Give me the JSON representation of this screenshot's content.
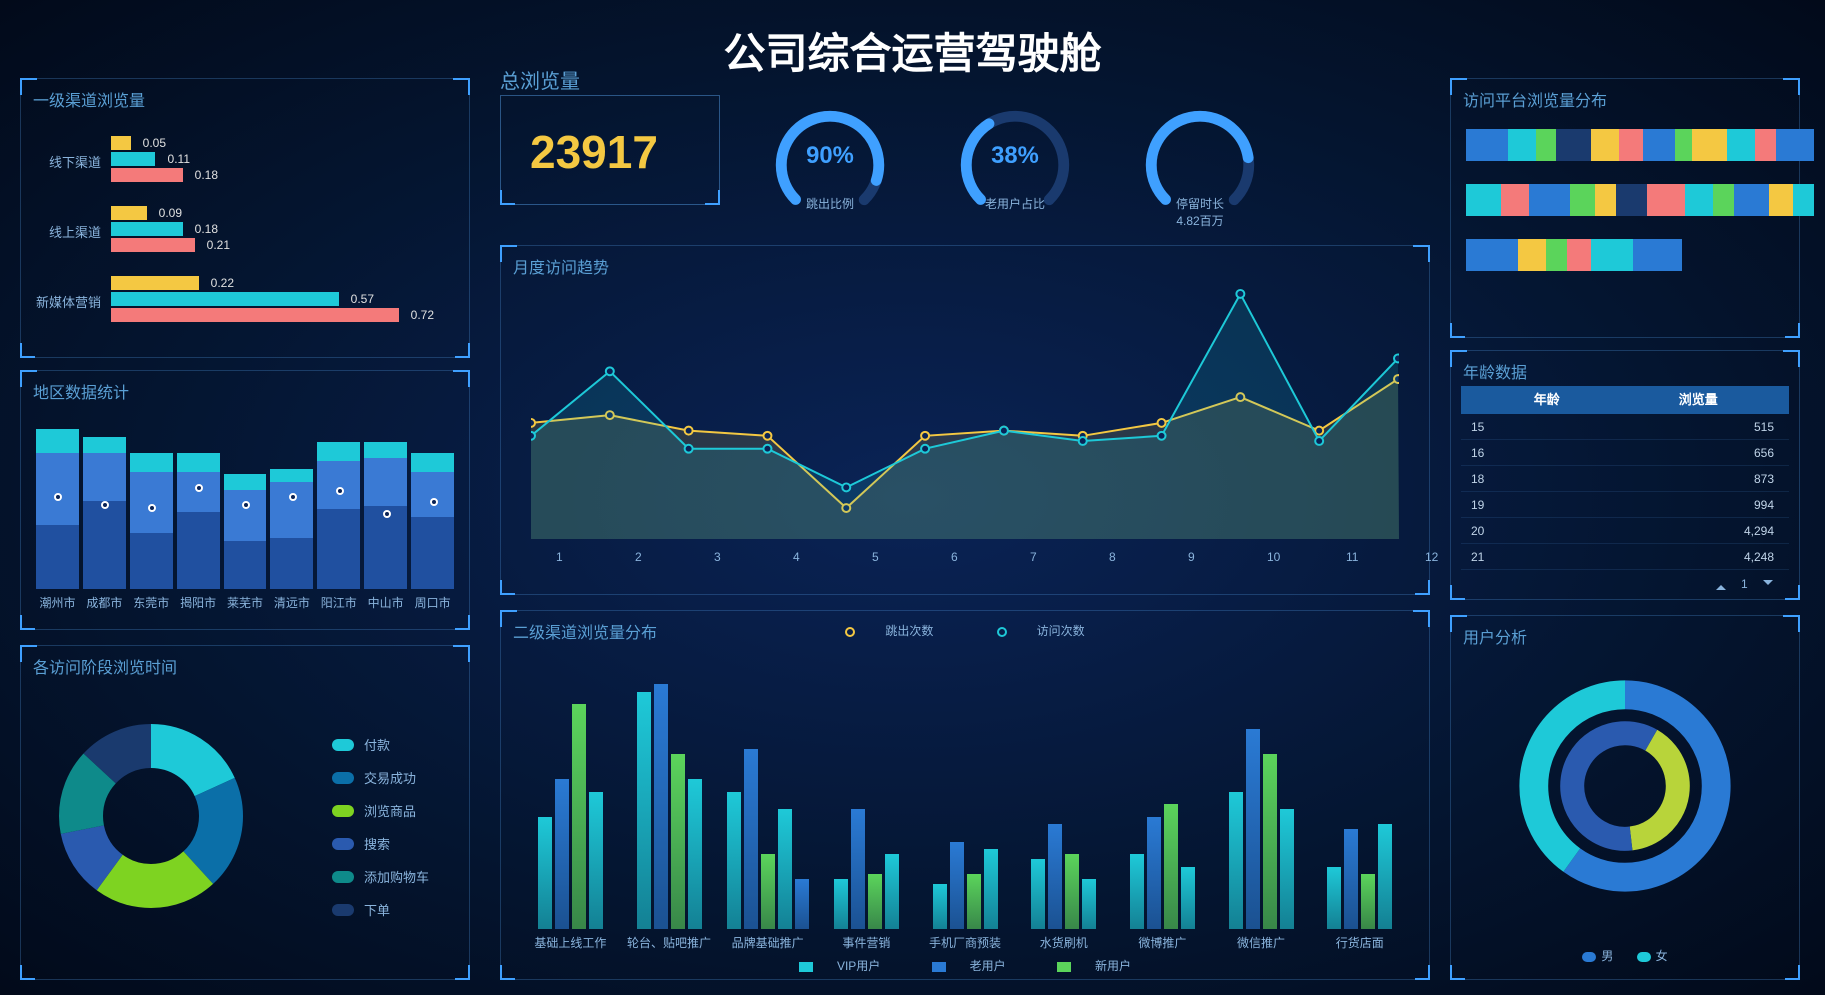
{
  "title": "公司综合运营驾驶舱",
  "kpi": {
    "label": "总浏览量",
    "value": "23917"
  },
  "gauges": [
    {
      "pct": 90,
      "text": "90%",
      "label": "跳出比例"
    },
    {
      "pct": 38,
      "text": "38%",
      "label": "老用户占比"
    },
    {
      "pct": 80,
      "text": "",
      "label": "停留时长\n4.82百万"
    }
  ],
  "tl": {
    "title": "一级渠道浏览量",
    "groups": [
      {
        "label": "线下渠道",
        "bars": [
          0.05,
          0.11,
          0.18
        ]
      },
      {
        "label": "线上渠道",
        "bars": [
          0.09,
          0.18,
          0.21
        ]
      },
      {
        "label": "新媒体营销",
        "bars": [
          0.22,
          0.57,
          0.72
        ]
      }
    ],
    "colors": [
      "#f4c842",
      "#1ec9d8",
      "#f47a7a"
    ]
  },
  "ml": {
    "title": "地区数据统计",
    "cats": [
      "潮州市",
      "成都市",
      "东莞市",
      "揭阳市",
      "莱芜市",
      "清远市",
      "阳江市",
      "中山市",
      "周口市"
    ],
    "stacks": [
      [
        40,
        45,
        15
      ],
      [
        55,
        30,
        10
      ],
      [
        35,
        38,
        12
      ],
      [
        48,
        25,
        12
      ],
      [
        30,
        32,
        10
      ],
      [
        32,
        35,
        8
      ],
      [
        50,
        30,
        12
      ],
      [
        52,
        30,
        10
      ],
      [
        45,
        28,
        12
      ]
    ],
    "line": [
      0.55,
      0.5,
      0.48,
      0.6,
      0.5,
      0.55,
      0.58,
      0.45,
      0.52
    ]
  },
  "bl": {
    "title": "各访问阶段浏览时间",
    "items": [
      {
        "label": "付款",
        "color": "#1ec9d8"
      },
      {
        "label": "交易成功",
        "color": "#0b6fa8"
      },
      {
        "label": "浏览商品",
        "color": "#7ed321"
      },
      {
        "label": "搜索",
        "color": "#2a5aaf"
      },
      {
        "label": "添加购物车",
        "color": "#0e8a8a"
      },
      {
        "label": "下单",
        "color": "#1a3a6e"
      }
    ]
  },
  "cm": {
    "title": "月度访问趋势",
    "x": [
      "1",
      "2",
      "3",
      "4",
      "5",
      "6",
      "7",
      "8",
      "9",
      "10",
      "11",
      "12"
    ],
    "series": [
      {
        "name": "跳出次数",
        "color": "#f4c842",
        "data": [
          0.45,
          0.48,
          0.42,
          0.4,
          0.12,
          0.4,
          0.42,
          0.4,
          0.45,
          0.55,
          0.42,
          0.62
        ]
      },
      {
        "name": "访问次数",
        "color": "#1ec9d8",
        "data": [
          0.4,
          0.65,
          0.35,
          0.35,
          0.2,
          0.35,
          0.42,
          0.38,
          0.4,
          0.95,
          0.38,
          0.7
        ]
      }
    ]
  },
  "cb": {
    "title": "二级渠道浏览量分布",
    "cats": [
      "基础上线工作",
      "轮台、贴吧推广",
      "品牌基础推广",
      "事件营销",
      "手机厂商预装",
      "水货刷机",
      "微博推广",
      "微信推广",
      "行货店面"
    ],
    "series": [
      "VIP用户",
      "老用户",
      "新用户"
    ],
    "colors": [
      "#1ec9d8",
      "#2a7ad4",
      "#5bd45b"
    ],
    "data": [
      [
        45,
        60,
        90,
        55
      ],
      [
        95,
        98,
        70,
        60
      ],
      [
        55,
        72,
        30,
        48,
        20
      ],
      [
        20,
        48,
        22,
        30
      ],
      [
        18,
        35,
        22,
        32
      ],
      [
        28,
        42,
        30,
        20
      ],
      [
        30,
        45,
        50,
        25
      ],
      [
        55,
        80,
        70,
        48
      ],
      [
        25,
        40,
        22,
        42
      ]
    ]
  },
  "rt": {
    "title": "访问平台浏览量分布",
    "rows": [
      [
        [
          "#2a7ad4",
          12
        ],
        [
          "#1ec9d8",
          8
        ],
        [
          "#5bd45b",
          6
        ],
        [
          "#1a3a6e",
          10
        ],
        [
          "#f4c842",
          8
        ],
        [
          "#f47a7a",
          7
        ],
        [
          "#2a7ad4",
          9
        ],
        [
          "#5bd45b",
          5
        ],
        [
          "#f4c842",
          10
        ],
        [
          "#1ec9d8",
          8
        ],
        [
          "#f47a7a",
          6
        ],
        [
          "#2a7ad4",
          11
        ]
      ],
      [
        [
          "#1ec9d8",
          10
        ],
        [
          "#f47a7a",
          8
        ],
        [
          "#2a7ad4",
          12
        ],
        [
          "#5bd45b",
          7
        ],
        [
          "#f4c842",
          6
        ],
        [
          "#1a3a6e",
          9
        ],
        [
          "#f47a7a",
          11
        ],
        [
          "#1ec9d8",
          8
        ],
        [
          "#5bd45b",
          6
        ],
        [
          "#2a7ad4",
          10
        ],
        [
          "#f4c842",
          7
        ],
        [
          "#1ec9d8",
          6
        ]
      ],
      [
        [
          "#2a7ad4",
          15
        ],
        [
          "#f4c842",
          8
        ],
        [
          "#5bd45b",
          6
        ],
        [
          "#f47a7a",
          7
        ],
        [
          "#1ec9d8",
          12
        ],
        [
          "#2a7ad4",
          14
        ]
      ]
    ]
  },
  "rm": {
    "title": "年龄数据",
    "headers": [
      "年龄",
      "浏览量"
    ],
    "rows": [
      [
        "15",
        "515"
      ],
      [
        "16",
        "656"
      ],
      [
        "18",
        "873"
      ],
      [
        "19",
        "994"
      ],
      [
        "20",
        "4,294"
      ],
      [
        "21",
        "4,248"
      ]
    ],
    "page": "1"
  },
  "rb": {
    "title": "用户分析",
    "legend": [
      "男",
      "女"
    ]
  },
  "chart_data": [
    {
      "type": "bar",
      "orientation": "horizontal",
      "title": "一级渠道浏览量",
      "categories": [
        "线下渠道",
        "线上渠道",
        "新媒体营销"
      ],
      "series": [
        {
          "name": "s1",
          "values": [
            0.05,
            0.09,
            0.22
          ]
        },
        {
          "name": "s2",
          "values": [
            0.11,
            0.18,
            0.57
          ]
        },
        {
          "name": "s3",
          "values": [
            0.18,
            0.21,
            0.72
          ]
        }
      ],
      "xlim": [
        0,
        0.8
      ]
    },
    {
      "type": "bar",
      "title": "地区数据统计",
      "stacked": true,
      "categories": [
        "潮州市",
        "成都市",
        "东莞市",
        "揭阳市",
        "莱芜市",
        "清远市",
        "阳江市",
        "中山市",
        "周口市"
      ],
      "series": [
        {
          "name": "seg1",
          "values": [
            40,
            55,
            35,
            48,
            30,
            32,
            50,
            52,
            45
          ]
        },
        {
          "name": "seg2",
          "values": [
            45,
            30,
            38,
            25,
            32,
            35,
            30,
            30,
            28
          ]
        },
        {
          "name": "seg3",
          "values": [
            15,
            10,
            12,
            12,
            10,
            8,
            12,
            10,
            12
          ]
        }
      ],
      "line_overlay": [
        0.55,
        0.5,
        0.48,
        0.6,
        0.5,
        0.55,
        0.58,
        0.45,
        0.52
      ]
    },
    {
      "type": "pie",
      "title": "各访问阶段浏览时间",
      "slices": [
        {
          "label": "付款",
          "value": 18
        },
        {
          "label": "交易成功",
          "value": 20
        },
        {
          "label": "浏览商品",
          "value": 22
        },
        {
          "label": "搜索",
          "value": 12
        },
        {
          "label": "添加购物车",
          "value": 15
        },
        {
          "label": "下单",
          "value": 13
        }
      ]
    },
    {
      "type": "line",
      "title": "月度访问趋势",
      "x": [
        1,
        2,
        3,
        4,
        5,
        6,
        7,
        8,
        9,
        10,
        11,
        12
      ],
      "series": [
        {
          "name": "跳出次数",
          "values": [
            0.45,
            0.48,
            0.42,
            0.4,
            0.12,
            0.4,
            0.42,
            0.4,
            0.45,
            0.55,
            0.42,
            0.62
          ]
        },
        {
          "name": "访问次数",
          "values": [
            0.4,
            0.65,
            0.35,
            0.35,
            0.2,
            0.35,
            0.42,
            0.38,
            0.4,
            0.95,
            0.38,
            0.7
          ]
        }
      ]
    },
    {
      "type": "bar",
      "title": "二级渠道浏览量分布",
      "grouped": true,
      "categories": [
        "基础上线工作",
        "轮台、贴吧推广",
        "品牌基础推广",
        "事件营销",
        "手机厂商预装",
        "水货刷机",
        "微博推广",
        "微信推广",
        "行货店面"
      ],
      "series_names": [
        "VIP用户",
        "老用户",
        "新用户"
      ],
      "ylim": [
        0,
        100
      ]
    },
    {
      "type": "bar",
      "orientation": "horizontal",
      "stacked": true,
      "title": "访问平台浏览量分布",
      "note": "three stacked percentage bars"
    },
    {
      "type": "table",
      "title": "年龄数据",
      "columns": [
        "年龄",
        "浏览量"
      ],
      "rows": [
        [
          "15",
          515
        ],
        [
          "16",
          656
        ],
        [
          "18",
          873
        ],
        [
          "19",
          994
        ],
        [
          "20",
          4294
        ],
        [
          "21",
          4248
        ]
      ]
    },
    {
      "type": "pie",
      "title": "用户分析",
      "donut": true,
      "series": [
        {
          "name": "男",
          "value": 60
        },
        {
          "name": "女",
          "value": 40
        }
      ]
    }
  ]
}
